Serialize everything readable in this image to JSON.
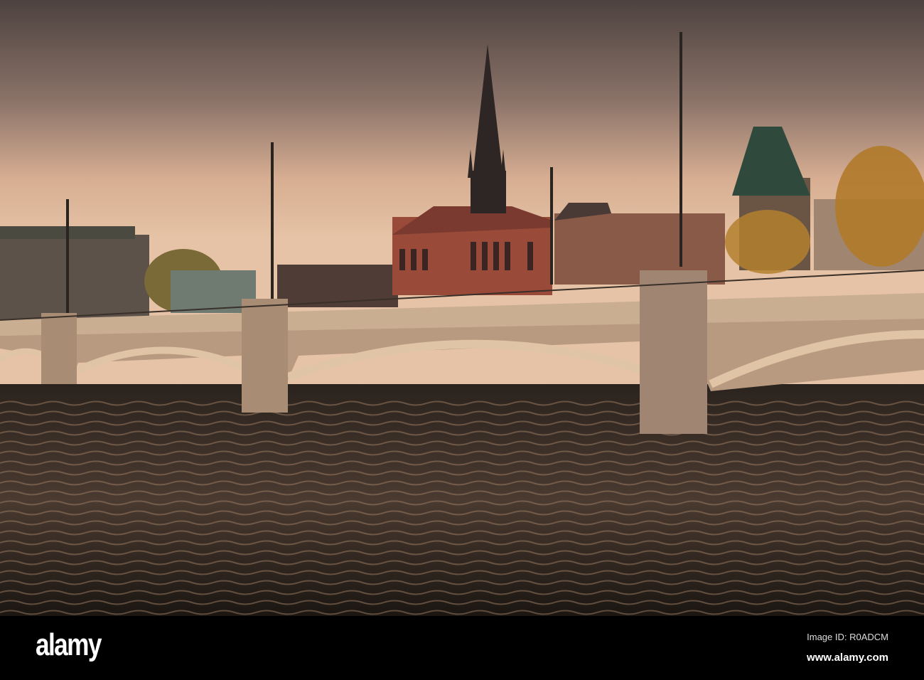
{
  "footer": {
    "logo": "alamy",
    "image_id": "Image ID: R0ADCM",
    "url": "www.alamy.com"
  },
  "colors": {
    "sky_top": "#5e4e4a",
    "sky_glow": "#e8c0a0",
    "water": "#1a1512",
    "bridge": "#c9ae92",
    "brick": "#9a4a38"
  }
}
